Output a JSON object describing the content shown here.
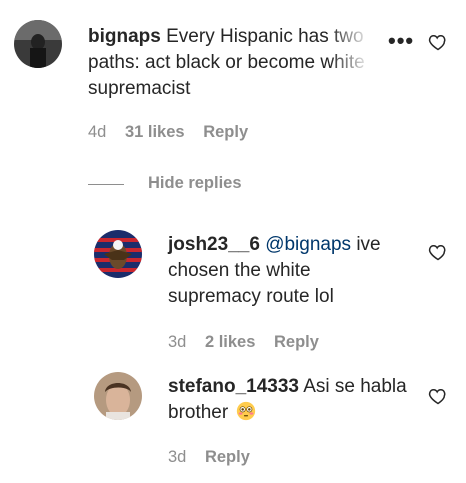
{
  "comments": [
    {
      "username": "bignaps",
      "text": "Every Hispanic has two paths: act black or become white supremacist",
      "age": "4d",
      "likes": "31 likes",
      "reply": "Reply",
      "more_icon": "more-options-icon"
    }
  ],
  "hide_replies_label": "Hide replies",
  "replies": [
    {
      "username": "josh23__6",
      "mention": "@bignaps",
      "text": "ive chosen the white supremacy route lol",
      "age": "3d",
      "likes": "2 likes",
      "reply": "Reply"
    },
    {
      "username": "stefano_14333",
      "text": "Asi se habla brother",
      "emoji": "flushed-face-emoji",
      "age": "3d",
      "reply": "Reply"
    }
  ],
  "colors": {
    "text": "#262626",
    "meta": "#8e8e8e",
    "mention": "#00376b"
  }
}
